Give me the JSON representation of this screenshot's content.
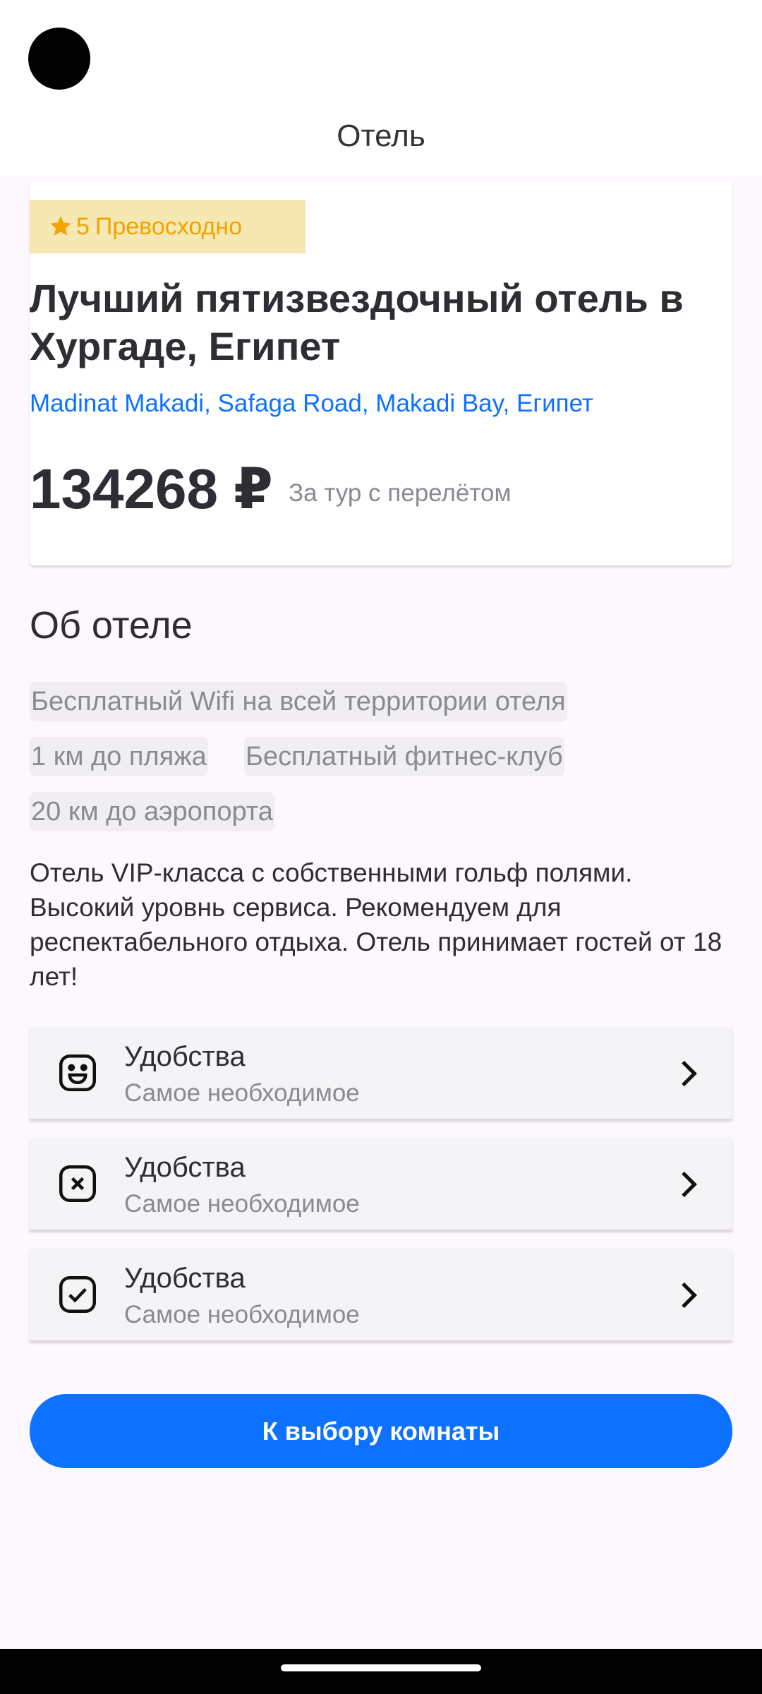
{
  "header": {
    "title": "Отель"
  },
  "hotel": {
    "rating_value": "5",
    "rating_label": "Превосходно",
    "name": "Лучший пятизвездочный отель в Хургаде, Египет",
    "address": "Madinat Makadi, Safaga Road, Makadi Bay, Египет",
    "price": "134268 ₽",
    "price_note": "За тур с перелётом",
    "rating_color": "#f2a400",
    "accent_color": "#0d72ff"
  },
  "about": {
    "title": "Об отеле",
    "tags": [
      "Бесплатный Wifi на всей территории отеля",
      "1 км до пляжа",
      "Бесплатный фитнес-клуб",
      "20 км до аэропорта"
    ],
    "description": "Отель VIP-класса с собственными гольф полями. Высокий уровнь сервиса. Рекомендуем для респектабельного отдыха. Отель принимает гостей от 18 лет!"
  },
  "amenities": [
    {
      "title": "Удобства",
      "subtitle": "Самое необходимое",
      "icon": "emoji-happy-icon"
    },
    {
      "title": "Удобства",
      "subtitle": "Самое необходимое",
      "icon": "close-square-icon"
    },
    {
      "title": "Удобства",
      "subtitle": "Самое необходимое",
      "icon": "tick-square-icon"
    }
  ],
  "cta": {
    "label": "К выбору комнаты"
  }
}
